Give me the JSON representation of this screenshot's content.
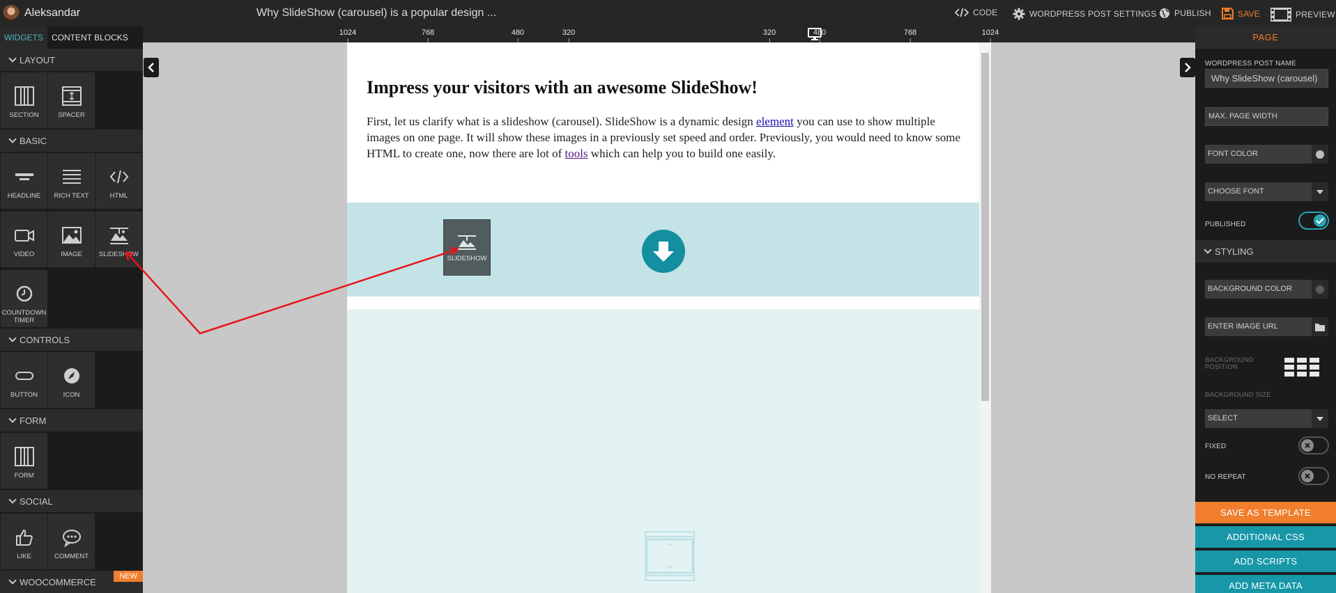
{
  "topbar": {
    "user_name": "Aleksandar",
    "page_title": "Why SlideShow (carousel) is a popular design ...",
    "code_label": "CODE",
    "wp_settings_label": "WORDPRESS POST SETTINGS",
    "publish_label": "PUBLISH",
    "save_label": "SAVE",
    "preview_label": "PREVIEW"
  },
  "left_panel": {
    "tabs": [
      "WIDGETS",
      "CONTENT BLOCKS"
    ],
    "categories": {
      "layout": {
        "title": "LAYOUT",
        "items": [
          "SECTION",
          "SPACER"
        ]
      },
      "basic": {
        "title": "BASIC",
        "items": [
          "HEADLINE",
          "RICH TEXT",
          "HTML",
          "VIDEO",
          "IMAGE",
          "SLIDESHOW",
          "COUNTDOWN TIMER"
        ]
      },
      "controls": {
        "title": "CONTROLS",
        "items": [
          "BUTTON",
          "ICON"
        ]
      },
      "form": {
        "title": "FORM",
        "items": [
          "FORM"
        ]
      },
      "social": {
        "title": "SOCIAL",
        "items": [
          "LIKE",
          "COMMENT"
        ]
      },
      "woocommerce": {
        "title": "WOOCOMMERCE",
        "badge": "NEW"
      }
    }
  },
  "ruler": {
    "ticks": [
      "1024",
      "768",
      "480",
      "320",
      "320",
      "480",
      "768",
      "1024"
    ]
  },
  "canvas": {
    "headline": "Impress your visitors with an awesome SlideShow!",
    "paragraph": {
      "part1": "First, let us clarify what is a slideshow (carousel). SlideShow is a dynamic design ",
      "link1": "element",
      "part2": " you can use to show multiple images on one page.  It will show these images in a previously set speed and order. Previously, you would need to know some HTML to create one, now there are lot of ",
      "link2": "tools",
      "part3": " which can help you to build one easily."
    },
    "drag_tile_label": "SLIDESHOW"
  },
  "right_panel": {
    "title": "PAGE",
    "wp_post_name_label": "WORDPRESS POST NAME",
    "wp_post_name_value": "Why SlideShow (carousel)",
    "max_width_placeholder": "MAX. PAGE WIDTH",
    "font_color_label": "FONT COLOR",
    "choose_font_label": "CHOOSE FONT",
    "published_label": "PUBLISHED",
    "published_on": true,
    "styling_title": "STYLING",
    "bg_color_label": "BACKGROUND COLOR",
    "image_url_placeholder": "ENTER IMAGE URL",
    "bg_position_label": "BACKGROUND POSITION",
    "bg_size_label": "BACKGROUND SIZE",
    "bg_size_value": "SELECT",
    "fixed_label": "FIXED",
    "fixed_on": false,
    "no_repeat_label": "NO REPEAT",
    "no_repeat_on": false,
    "save_template_label": "SAVE AS TEMPLATE",
    "additional_css_label": "ADDITIONAL CSS",
    "add_scripts_label": "ADD SCRIPTS",
    "add_meta_label": "ADD META DATA"
  },
  "colors": {
    "accent_orange": "#f07e2c",
    "accent_teal": "#148ea1",
    "section_blue": "#c4e3e6",
    "annotation_red": "#e8141c"
  }
}
